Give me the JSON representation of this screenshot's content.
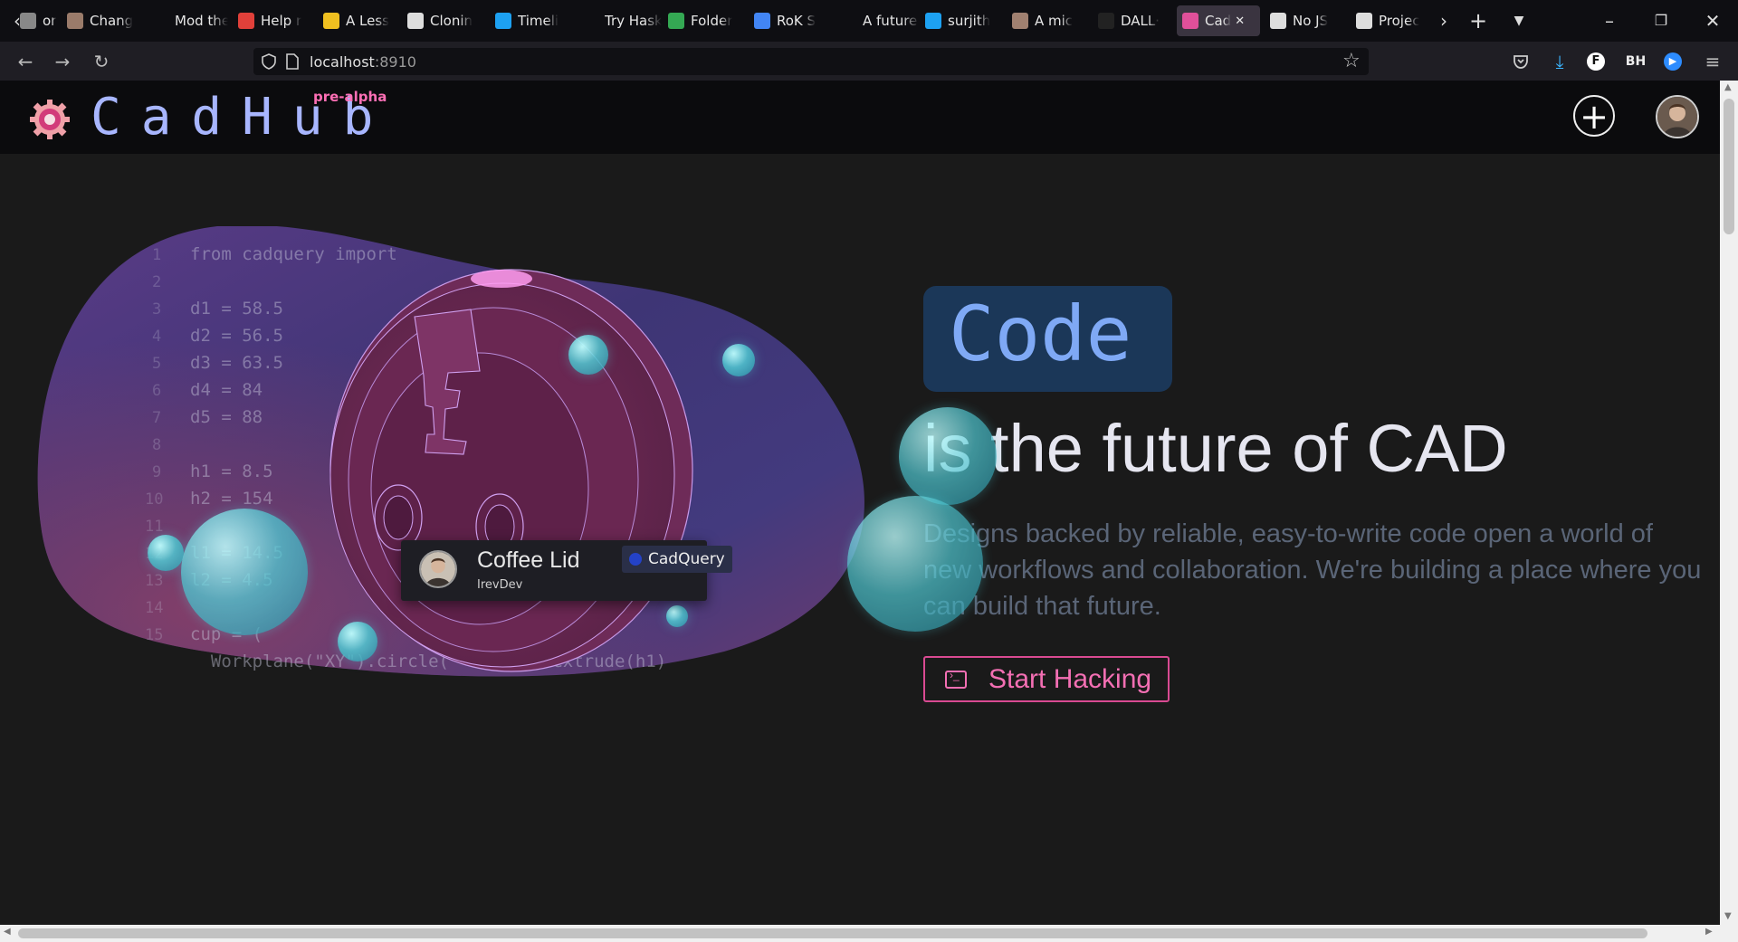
{
  "browser": {
    "tabs": [
      {
        "label": "on",
        "color": "#888888"
      },
      {
        "label": "Chang",
        "color": "#9a7b6a"
      },
      {
        "label": "Mod the M",
        "color": "#0e0e12"
      },
      {
        "label": "Help r",
        "color": "#e0403a"
      },
      {
        "label": "A Less",
        "color": "#f0c020"
      },
      {
        "label": "Clonin",
        "color": "#dddddd"
      },
      {
        "label": "Timeli",
        "color": "#1da1f2"
      },
      {
        "label": "Try Haskel",
        "color": "#0e0e12"
      },
      {
        "label": "Folder",
        "color": "#34a853"
      },
      {
        "label": "RoK S",
        "color": "#4285f4"
      },
      {
        "label": "A future fo",
        "color": "#0e0e12"
      },
      {
        "label": "surjith",
        "color": "#1da1f2"
      },
      {
        "label": "A mic",
        "color": "#a08070"
      },
      {
        "label": "DALL·",
        "color": "#222222"
      },
      {
        "label": "Cad",
        "color": "#e0509a"
      },
      {
        "label": "No JS",
        "color": "#dddddd"
      },
      {
        "label": "Projec",
        "color": "#dddddd"
      }
    ],
    "url_host": "localhost",
    "url_port": ":8910"
  },
  "header": {
    "logo_text": "CadHub",
    "badge": "pre-alpha"
  },
  "hero": {
    "code_lines": [
      {
        "n": "1",
        "text": "from cadquery import"
      },
      {
        "n": "2",
        "text": ""
      },
      {
        "n": "3",
        "text": "d1 = 58.5"
      },
      {
        "n": "4",
        "text": "d2 = 56.5"
      },
      {
        "n": "5",
        "text": "d3 = 63.5"
      },
      {
        "n": "6",
        "text": "d4 = 84"
      },
      {
        "n": "7",
        "text": "d5 = 88"
      },
      {
        "n": "8",
        "text": ""
      },
      {
        "n": "9",
        "text": "h1 = 8.5"
      },
      {
        "n": "10",
        "text": "h2 = 154"
      },
      {
        "n": "11",
        "text": ""
      },
      {
        "n": "12",
        "text": "l1 = 14.5"
      },
      {
        "n": "13",
        "text": "l2 = 4.5"
      },
      {
        "n": "14",
        "text": ""
      },
      {
        "n": "15",
        "text": "cup = ("
      },
      {
        "n": "",
        "text": "  Workplane(\"XY\").circle(        ).extrude(h1)"
      }
    ],
    "card": {
      "title": "Coffee Lid",
      "user": "IrevDev",
      "tag": "CadQuery"
    },
    "code_word": "Code",
    "headline_is": "is",
    "headline_rest": " the future of CAD",
    "description": "Designs backed by reliable, easy-to-write code open a world of new workflows and collaboration. We're building a place where you can build that future.",
    "cta": "Start Hacking"
  },
  "colors": {
    "logo": "#a8b6ff",
    "badge": "#ff6fb5",
    "code_word": "#7fa9f5",
    "cta": "#f36fb3"
  }
}
